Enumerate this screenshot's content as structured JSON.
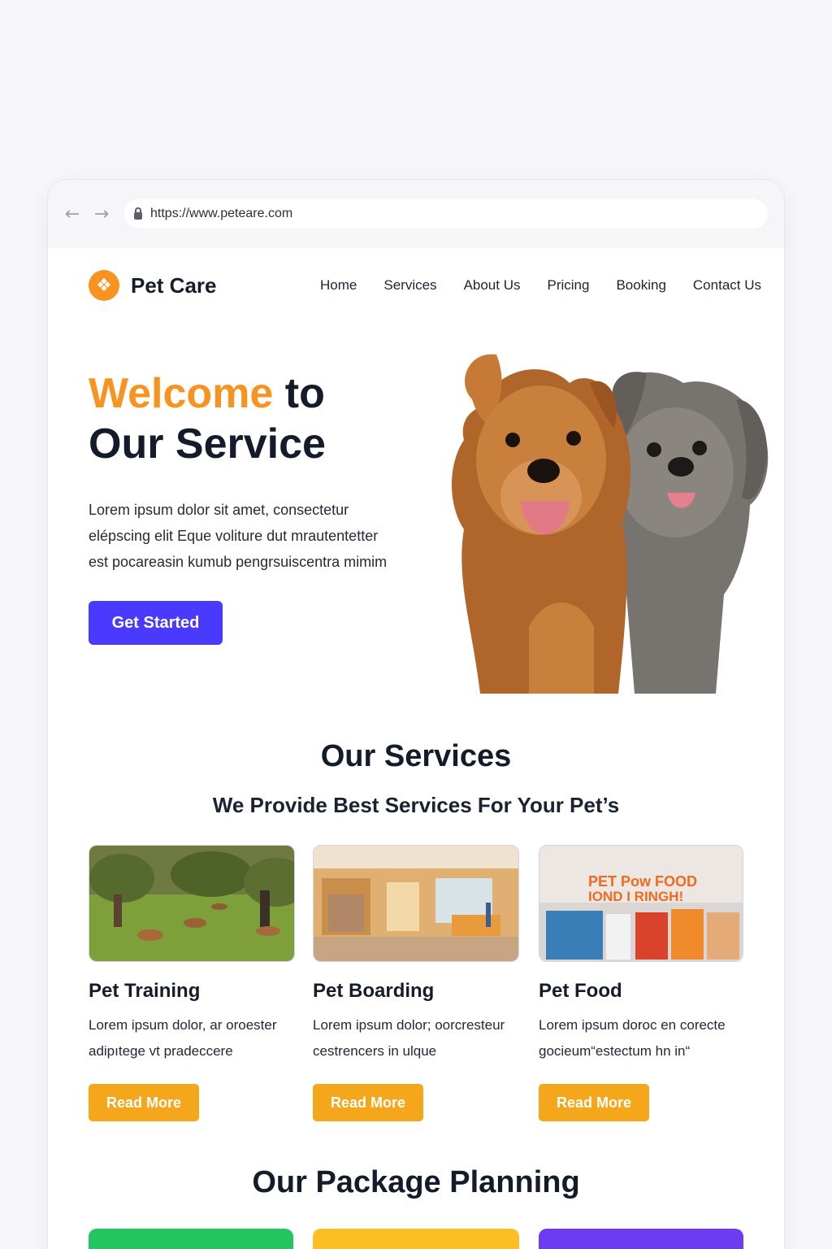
{
  "browser": {
    "url": "https://www.peteare.com",
    "back_icon": "arrow-left-icon",
    "forward_icon": "arrow-right-icon"
  },
  "header": {
    "brand": "Pet Care",
    "nav": [
      "Home",
      "Services",
      "About Us",
      "Pricing",
      "Booking",
      "Contact Us"
    ]
  },
  "hero": {
    "title_accent": "Welcome",
    "title_rest_1": " to",
    "title_line_2": "Our Service",
    "text": "Lorem ipsum dolor sit amet, consectetur elépscing elit Eque voliture dut mrautentetter est pocareasin kumub pengrsuiscentra mimim",
    "cta_label": "Get Started"
  },
  "services": {
    "title": "Our Services",
    "subtitle": "We Provide Best Services For Your Pet’s",
    "cards": [
      {
        "title": "Pet Training",
        "text": "Lorem ipsum dolor, ar oroester adipıtege vt pradeccere",
        "button": "Read More"
      },
      {
        "title": "Pet Boarding",
        "text": "Lorem ipsum dolor; oorcresteur cestrencers in ulque",
        "button": "Read More"
      },
      {
        "title": "Pet Food",
        "text": "Lorem ipsum doroc en corecte gocieum“estectum hn in“",
        "button": "Read More",
        "image_sign": [
          "PET Pow FOOD",
          "IOND I RINGH!"
        ]
      }
    ]
  },
  "packages": {
    "title": "Our Package Planning"
  },
  "colors": {
    "accent_orange": "#f7931e",
    "primary_blue": "#4a3aff",
    "button_yellow": "#f5a71b",
    "package_green": "#22c55e",
    "package_yellow": "#fbbf24",
    "package_purple": "#6d3cf0"
  }
}
